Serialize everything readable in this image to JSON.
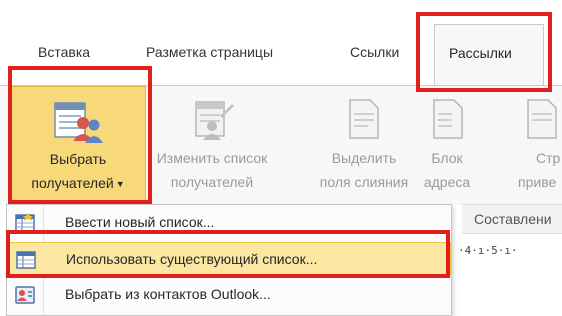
{
  "tabs": {
    "insert": "Вставка",
    "page_layout": "Разметка страницы",
    "references": "Ссылки",
    "mailings": "Рассылки"
  },
  "ribbon": {
    "select_recipients": {
      "line1": "Выбрать",
      "line2": "получателей"
    },
    "edit_recipient_list": {
      "line1": "Изменить список",
      "line2": "получателей"
    },
    "highlight_merge_fields": {
      "line1": "Выделить",
      "line2": "поля слияния"
    },
    "address_block": {
      "line1": "Блок",
      "line2": "адреса"
    },
    "greeting_line": {
      "line1": "Стр",
      "line2": "приве"
    },
    "group_caption": "Составлени"
  },
  "ruler": {
    "marks": "·4·ı·5·ı·"
  },
  "menu": {
    "items": [
      {
        "label": "Ввести новый список...",
        "icon": "new-list-icon",
        "highlighted": false
      },
      {
        "label": "Использовать существующий список...",
        "icon": "existing-list-icon",
        "highlighted": true
      },
      {
        "label": "Выбрать из контактов Outlook...",
        "icon": "outlook-contacts-icon",
        "highlighted": false
      }
    ]
  },
  "colors": {
    "accent_red": "#e0201b",
    "selected_button": "#f8d97a",
    "menu_highlight": "#fbe6a2",
    "ribbon_bg": "#f7f7f7"
  }
}
